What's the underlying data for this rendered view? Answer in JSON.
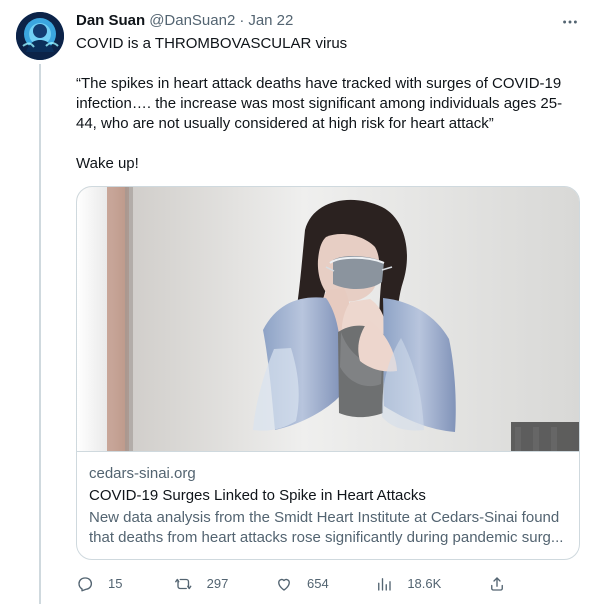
{
  "tweet": {
    "author_name": "Dan Suan",
    "author_handle": "@DanSuan2",
    "separator": "·",
    "date": "Jan 22",
    "more_label": "···",
    "paragraphs": [
      "COVID is a THROMBOVASCULAR virus",
      "“The spikes in heart attack deaths have tracked with surges of COVID-19 infection…. the increase was most significant among individuals ages 25-44, who are not usually considered at high risk for heart attack”",
      "Wake up!"
    ]
  },
  "card": {
    "domain": "cedars-sinai.org",
    "title": "COVID-19 Surges Linked to Spike in Heart Attacks",
    "description": "New data analysis from the Smidt Heart Institute at Cedars-Sinai found that deaths from heart attacks rose significantly during pandemic surg..."
  },
  "actions": {
    "reply_count": "15",
    "retweet_count": "297",
    "like_count": "654",
    "views_count": "18.6K"
  },
  "icons": {
    "reply": "reply-icon",
    "retweet": "retweet-icon",
    "like": "heart-icon",
    "views": "views-icon",
    "share": "share-icon",
    "more": "more-icon"
  },
  "colors": {
    "text": "#0f1419",
    "secondary": "#536471",
    "border": "#cfd9de"
  }
}
